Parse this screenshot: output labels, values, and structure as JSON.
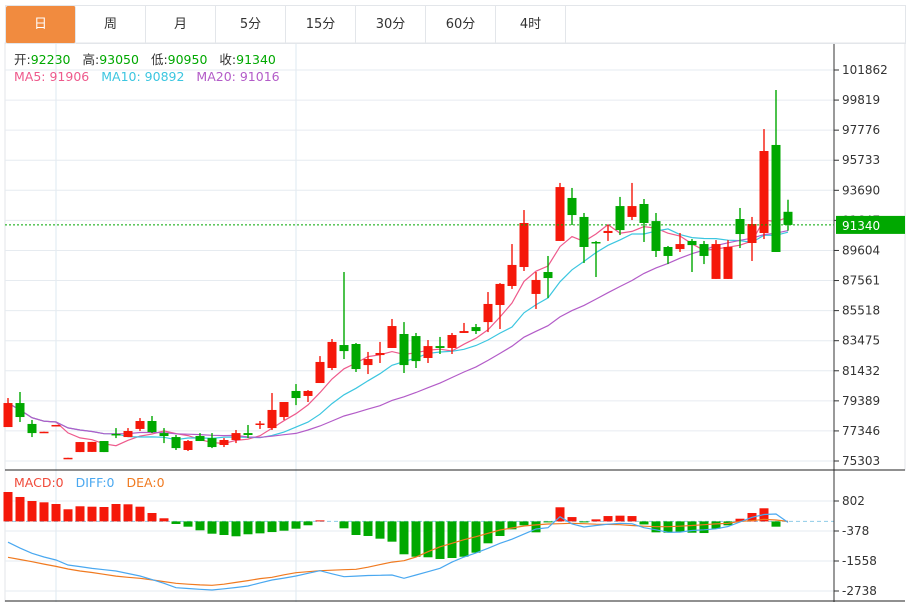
{
  "tabs": [
    {
      "label": "日",
      "active": true
    },
    {
      "label": "周"
    },
    {
      "label": "月"
    },
    {
      "label": "5分"
    },
    {
      "label": "15分"
    },
    {
      "label": "30分"
    },
    {
      "label": "60分"
    },
    {
      "label": "4时"
    }
  ],
  "legend": {
    "open_label": "开:",
    "open": "92230",
    "high_label": "高:",
    "high": "93050",
    "low_label": "低:",
    "low": "90950",
    "close_label": "收:",
    "close": "91340",
    "ma5": "MA5: 91906",
    "ma10": "MA10: 90892",
    "ma20": "MA20: 91016",
    "macd": "MACD:0",
    "diff": "DIFF:0",
    "dea": "DEA:0"
  },
  "colors": {
    "up": "#f5180a",
    "down": "#00a800",
    "active_tab": "#f18b3f",
    "ma5": "#ee5a8c",
    "ma10": "#3cc6e0",
    "ma20": "#b35cc8",
    "diff": "#4aa8f0",
    "dea": "#f07a20",
    "macd_label": "#f04a3a"
  },
  "chart_data": [
    {
      "type": "candlestick",
      "convention": "red = rising, green = falling",
      "y_ticks": [
        "101862",
        "99819",
        "97776",
        "95733",
        "93690",
        "91647",
        "89604",
        "87561",
        "85518",
        "83475",
        "81432",
        "79389",
        "77346",
        "75303"
      ],
      "last_price": "91340",
      "ma_periods": [
        5,
        10,
        20
      ],
      "ohlc": [
        [
          77610,
          79580,
          77610,
          79240
        ],
        [
          79240,
          79990,
          77950,
          78290
        ],
        [
          77820,
          78090,
          76930,
          77200
        ],
        [
          77270,
          77290,
          77270,
          77290
        ],
        [
          77750,
          77750,
          77750,
          77750
        ],
        [
          75500,
          75520,
          75500,
          75520
        ],
        [
          75910,
          76590,
          75910,
          76590
        ],
        [
          75920,
          76600,
          75920,
          76600
        ],
        [
          76660,
          76660,
          75910,
          75910
        ],
        [
          77140,
          77540,
          76860,
          77100
        ],
        [
          76930,
          77540,
          76930,
          77340
        ],
        [
          77480,
          78220,
          77340,
          78020
        ],
        [
          78020,
          78360,
          77200,
          77270
        ],
        [
          77200,
          77540,
          76520,
          77000
        ],
        [
          76930,
          77070,
          76050,
          76180
        ],
        [
          76050,
          76730,
          75980,
          76660
        ],
        [
          77000,
          77200,
          76660,
          76660
        ],
        [
          76860,
          77200,
          76180,
          76250
        ],
        [
          76390,
          76860,
          76250,
          76730
        ],
        [
          76730,
          77410,
          76520,
          77200
        ],
        [
          77200,
          77750,
          76860,
          77070
        ],
        [
          77780,
          78020,
          77480,
          77850
        ],
        [
          77540,
          79920,
          77410,
          78770
        ],
        [
          78290,
          79310,
          78090,
          79310
        ],
        [
          80060,
          80530,
          79100,
          79580
        ],
        [
          79720,
          80120,
          79310,
          80060
        ],
        [
          80600,
          82430,
          80600,
          82030
        ],
        [
          81620,
          83590,
          81480,
          83390
        ],
        [
          83180,
          88140,
          82230,
          82770
        ],
        [
          83250,
          83320,
          81350,
          81550
        ],
        [
          81820,
          82710,
          81210,
          82230
        ],
        [
          82500,
          83390,
          81960,
          82640
        ],
        [
          82980,
          84950,
          82980,
          84470
        ],
        [
          83930,
          84740,
          81280,
          81820
        ],
        [
          83790,
          84000,
          81620,
          82090
        ],
        [
          82300,
          83520,
          81960,
          83110
        ],
        [
          83110,
          83730,
          82570,
          82980
        ],
        [
          82980,
          84000,
          82570,
          83860
        ],
        [
          84000,
          84680,
          84000,
          84130
        ],
        [
          84400,
          84610,
          83930,
          84130
        ],
        [
          84740,
          86780,
          84060,
          85970
        ],
        [
          85900,
          87390,
          84270,
          87330
        ],
        [
          87190,
          90040,
          86990,
          88620
        ],
        [
          88480,
          92350,
          88210,
          91470
        ],
        [
          86650,
          88140,
          85630,
          87600
        ],
        [
          88140,
          89230,
          86370,
          87730
        ],
        [
          90250,
          94190,
          90250,
          93910
        ],
        [
          93170,
          93850,
          91330,
          92010
        ],
        [
          91880,
          92150,
          88750,
          89840
        ],
        [
          90180,
          90250,
          87800,
          90110
        ],
        [
          90790,
          91330,
          90250,
          90930
        ],
        [
          92620,
          93240,
          90650,
          90990
        ],
        [
          91880,
          94190,
          91670,
          92620
        ],
        [
          92760,
          93100,
          90180,
          91470
        ],
        [
          91600,
          92150,
          89160,
          89570
        ],
        [
          89840,
          89910,
          88680,
          89230
        ],
        [
          89700,
          90790,
          89500,
          90040
        ],
        [
          90250,
          90380,
          88140,
          89970
        ],
        [
          90040,
          90250,
          88680,
          89230
        ],
        [
          87670,
          90310,
          87670,
          90040
        ],
        [
          87670,
          90310,
          87670,
          89840
        ],
        [
          91740,
          92490,
          89770,
          90720
        ],
        [
          90110,
          91880,
          88890,
          91400
        ],
        [
          90790,
          97850,
          90380,
          96360
        ],
        [
          96770,
          100500,
          89500,
          89500
        ],
        [
          92230,
          93050,
          90950,
          91340
        ]
      ]
    },
    {
      "type": "macd",
      "y_ticks": [
        "802",
        "-378",
        "-1558",
        "-2738"
      ],
      "histogram": [
        1156,
        960,
        802,
        750,
        684,
        476,
        594,
        578,
        566,
        684,
        672,
        578,
        330,
        122,
        -102,
        -208,
        -350,
        -484,
        -535,
        -586,
        -507,
        -470,
        -420,
        -366,
        -287,
        -153,
        40,
        0,
        -272,
        -535,
        -574,
        -680,
        -798,
        -1294,
        -1390,
        -1412,
        -1478,
        -1440,
        -1390,
        -1230,
        -862,
        -575,
        -312,
        -155,
        -430,
        -40,
        555,
        170,
        -40,
        80,
        210,
        225,
        210,
        -120,
        -430,
        -445,
        -405,
        -445,
        -458,
        -287,
        -155,
        105,
        330,
        515,
        -208,
        0
      ],
      "diff": [
        -820,
        -1050,
        -1256,
        -1400,
        -1518,
        -1715,
        -1780,
        -1850,
        -1900,
        -1950,
        -2050,
        -2147,
        -2290,
        -2436,
        -2607,
        -2640,
        -2670,
        -2698,
        -2650,
        -2600,
        -2541,
        -2420,
        -2305,
        -2230,
        -2147,
        -2040,
        -1939,
        -2060,
        -2175,
        -2150,
        -2130,
        -2120,
        -2108,
        -2238,
        -2110,
        -1978,
        -1845,
        -1600,
        -1400,
        -1240,
        -1060,
        -862,
        -700,
        -500,
        -300,
        -250,
        185,
        -100,
        -220,
        -160,
        -110,
        -75,
        -90,
        -250,
        -330,
        -430,
        -420,
        -360,
        -330,
        -290,
        -200,
        -24,
        160,
        270,
        290,
        -40
      ],
      "dea": [
        -1412,
        -1500,
        -1584,
        -1680,
        -1770,
        -1872,
        -1950,
        -2010,
        -2080,
        -2150,
        -2200,
        -2238,
        -2300,
        -2370,
        -2436,
        -2470,
        -2500,
        -2513,
        -2470,
        -2400,
        -2330,
        -2250,
        -2200,
        -2100,
        -2017,
        -1980,
        -1939,
        -1920,
        -1900,
        -1885,
        -1800,
        -1700,
        -1600,
        -1546,
        -1400,
        -1192,
        -1000,
        -862,
        -720,
        -601,
        -470,
        -338,
        -260,
        -181,
        -140,
        -102,
        -90,
        -75,
        -90,
        -110,
        -120,
        -130,
        -160,
        -190,
        -208,
        -208,
        -190,
        -160,
        -130,
        -100,
        -75,
        0,
        28,
        83,
        55,
        0
      ]
    }
  ]
}
